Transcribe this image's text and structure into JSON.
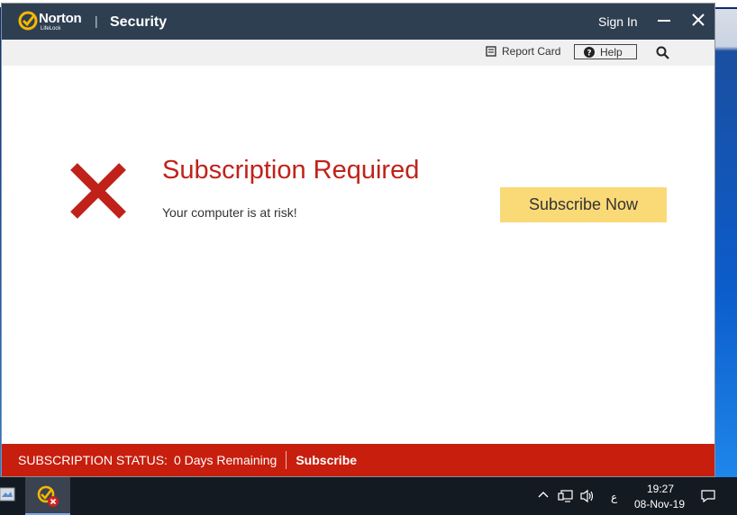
{
  "window": {
    "brand": "Norton",
    "brand_sub": "LifeLock",
    "title": "Security",
    "sign_in": "Sign In"
  },
  "toolbar": {
    "report_card": "Report Card",
    "help": "Help"
  },
  "alert": {
    "title": "Subscription Required",
    "description": "Your computer is at risk!",
    "button": "Subscribe Now"
  },
  "status": {
    "label": "SUBSCRIPTION STATUS:",
    "value": "0 Days Remaining",
    "link": "Subscribe"
  },
  "taskbar": {
    "language": "ع",
    "time": "19:27",
    "date": "08-Nov-19"
  },
  "colors": {
    "titlebar": "#2f3f52",
    "accent_red": "#c0221a",
    "status_bar": "#c81e0e",
    "button_yellow": "#fad977"
  }
}
